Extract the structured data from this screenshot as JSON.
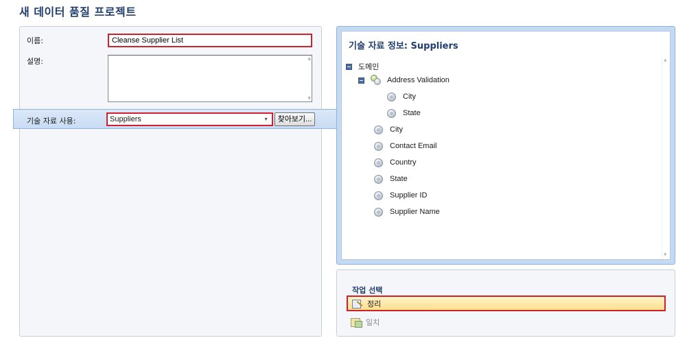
{
  "page": {
    "title": "새 데이터 품질 프로젝트"
  },
  "form": {
    "name_label": "이름:",
    "name_value": "Cleanse Supplier List",
    "description_label": "설명:",
    "description_value": "",
    "use_kb_label": "기술 자료 사용:",
    "kb_selected": "Suppliers",
    "browse_label": "찾아보기..."
  },
  "kb_info": {
    "title": "기술 자료 정보: Suppliers",
    "root_label": "도메인",
    "composite_domain": {
      "label": "Address Validation",
      "children": [
        "City",
        "State"
      ]
    },
    "domains": [
      "City",
      "Contact Email",
      "Country",
      "State",
      "Supplier ID",
      "Supplier Name"
    ]
  },
  "actions": {
    "title": "작업 선택",
    "items": [
      {
        "label": "정리",
        "selected": true
      },
      {
        "label": "일치",
        "selected": false
      }
    ]
  },
  "colors": {
    "accent": "#1f3e6f",
    "highlight_border": "#d0202e",
    "selection_bg": "#fde08c",
    "panel_blue": "#c4d9f2"
  },
  "icons": {
    "collapse": "collapse-minus-icon",
    "domain": "domain-node-icon",
    "composite_domain": "composite-domain-icon",
    "cleanse": "cleanse-icon",
    "match": "match-icon"
  }
}
